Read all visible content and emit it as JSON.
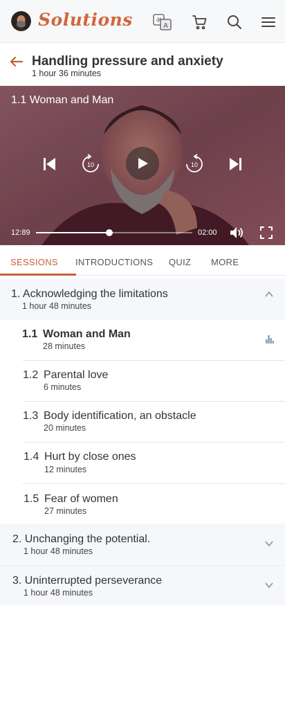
{
  "header": {
    "brand": "Solutions",
    "brand_color": "#d2663a",
    "icons": [
      "translate-icon",
      "cart-icon",
      "search-icon",
      "menu-icon"
    ]
  },
  "course": {
    "title": "Handling pressure and anxiety",
    "duration": "1 hour 36 minutes"
  },
  "player": {
    "now_playing": "1.1  Woman and Man",
    "current_time": "12:89",
    "remaining_time": "02:00",
    "progress_fraction": 0.47,
    "skip_seconds": "10"
  },
  "tabs": [
    {
      "label": "SESSIONS",
      "active": true
    },
    {
      "label": "INTRODUCTIONS",
      "active": false
    },
    {
      "label": "QUIZ",
      "active": false
    },
    {
      "label": "MORE",
      "active": false
    }
  ],
  "chapters": [
    {
      "title": "1. Acknowledging the limitations",
      "duration": "1 hour 48 minutes",
      "expanded": true,
      "sessions": [
        {
          "num": "1.1",
          "title": "Woman and Man",
          "duration": "28 minutes",
          "playing": true
        },
        {
          "num": "1.2",
          "title": "Parental love",
          "duration": "6 minutes"
        },
        {
          "num": "1.3",
          "title": "Body identification, an obstacle",
          "duration": "20 minutes"
        },
        {
          "num": "1.4",
          "title": "Hurt by close ones",
          "duration": "12 minutes"
        },
        {
          "num": "1.5",
          "title": "Fear of women",
          "duration": "27 minutes"
        }
      ]
    },
    {
      "title": "2. Unchanging the potential.",
      "duration": "1 hour 48 minutes",
      "expanded": false
    },
    {
      "title": "3. Uninterrupted perseverance",
      "duration": "1 hour 48 minutes",
      "expanded": false
    }
  ],
  "accent_color": "#c5623a"
}
